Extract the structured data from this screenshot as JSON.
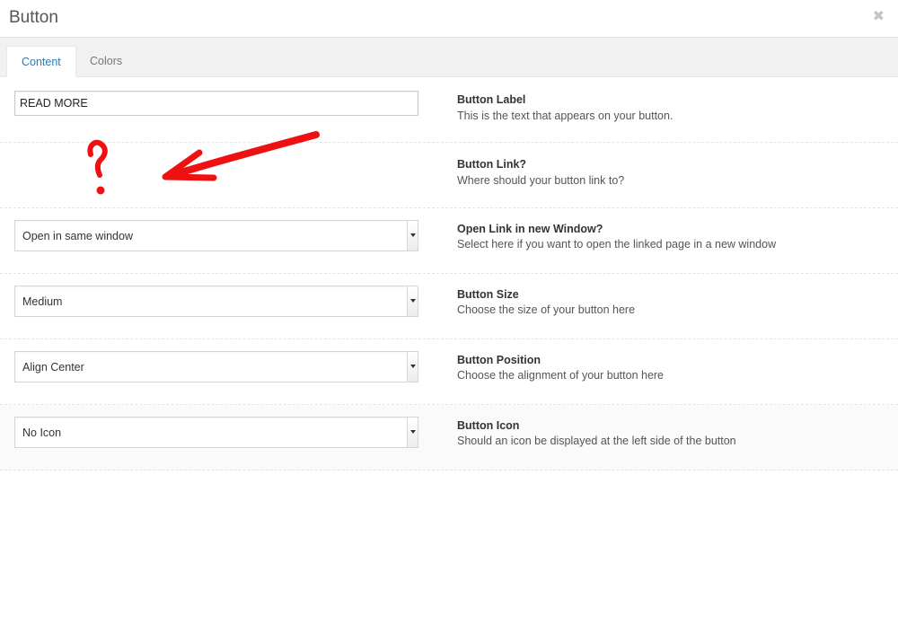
{
  "dialog": {
    "title": "Button",
    "close_icon": "close-icon"
  },
  "tabs": [
    {
      "label": "Content",
      "active": true
    },
    {
      "label": "Colors",
      "active": false
    }
  ],
  "fields": {
    "label": {
      "title": "Button Label",
      "description": "This is the text that appears on your button.",
      "value": "READ MORE"
    },
    "link": {
      "title": "Button Link?",
      "description": "Where should your button link to?"
    },
    "window": {
      "title": "Open Link in new Window?",
      "description": "Select here if you want to open the linked page in a new window",
      "selected": "Open in same window"
    },
    "size": {
      "title": "Button Size",
      "description": "Choose the size of your button here",
      "selected": "Medium"
    },
    "position": {
      "title": "Button Position",
      "description": "Choose the alignment of your button here",
      "selected": "Align Center"
    },
    "icon": {
      "title": "Button Icon",
      "description": "Should an icon be displayed at the left side of the button",
      "selected": "No Icon"
    }
  },
  "annotation": {
    "arrow_color": "#ee1111"
  },
  "colors": {
    "active_tab_text": "#2b7bb0",
    "tabbar_bg": "#f1f1f1"
  }
}
